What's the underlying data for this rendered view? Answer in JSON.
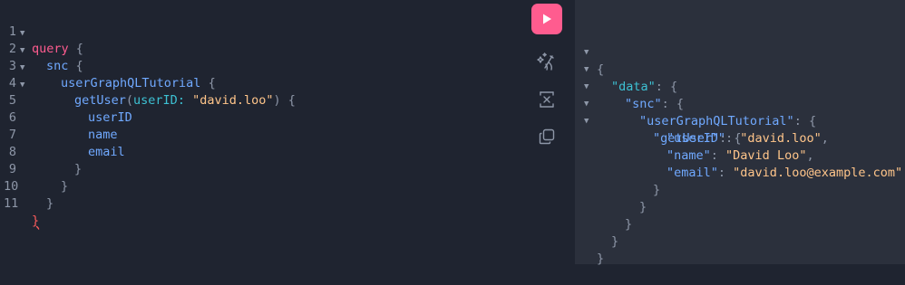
{
  "editor": {
    "line_numbers": [
      "1",
      "2",
      "3",
      "4",
      "5",
      "6",
      "7",
      "8",
      "9",
      "10",
      "11"
    ],
    "lines": [
      {
        "kw": "query",
        "brace": "{"
      },
      {
        "field": "snc",
        "brace": "{"
      },
      {
        "field": "userGraphQLTutorial",
        "brace": "{"
      },
      {
        "field": "getUser",
        "paren_open": "(",
        "arg": "userID",
        "colon": ":",
        "string": "\"david.loo\"",
        "paren_close": ")",
        "brace": "{"
      },
      {
        "field": "userID"
      },
      {
        "field": "name"
      },
      {
        "field": "email"
      },
      {
        "brace": "}"
      },
      {
        "brace": "}"
      },
      {
        "brace": "}"
      },
      {
        "brace": "}"
      }
    ]
  },
  "toolbar": {
    "run_icon": "play-icon",
    "prettify_icon": "magic-wand-icon",
    "merge_icon": "merge-fragments-icon",
    "copy_icon": "copy-icon"
  },
  "result": {
    "lines": [
      {
        "text": "{"
      },
      {
        "key": "\"data\"",
        "sep": ": ",
        "text": "{"
      },
      {
        "key": "\"snc\"",
        "sep": ": ",
        "text": "{"
      },
      {
        "key": "\"userGraphQLTutorial\"",
        "sep": ": ",
        "text": "{"
      },
      {
        "key": "\"getUser\"",
        "sep": ": ",
        "text": "{"
      },
      {
        "key": "\"userID\"",
        "sep": ": ",
        "value": "\"david.loo\"",
        "tail": ","
      },
      {
        "key": "\"name\"",
        "sep": ": ",
        "value": "\"David Loo\"",
        "tail": ","
      },
      {
        "key": "\"email\"",
        "sep": ": ",
        "value": "\"david.loo@example.com\"",
        "tail": ""
      },
      {
        "text": "}"
      },
      {
        "text": "}"
      },
      {
        "text": "}"
      },
      {
        "text": "}"
      },
      {
        "text": "}"
      }
    ]
  },
  "colors": {
    "keyword": "#ff5c8f",
    "field": "#70a9ff",
    "argument": "#3dc1d3",
    "string": "#ffc58a",
    "run_button": "#ff5c8f",
    "editor_bg": "#1f2430",
    "result_bg": "#2b303c"
  }
}
